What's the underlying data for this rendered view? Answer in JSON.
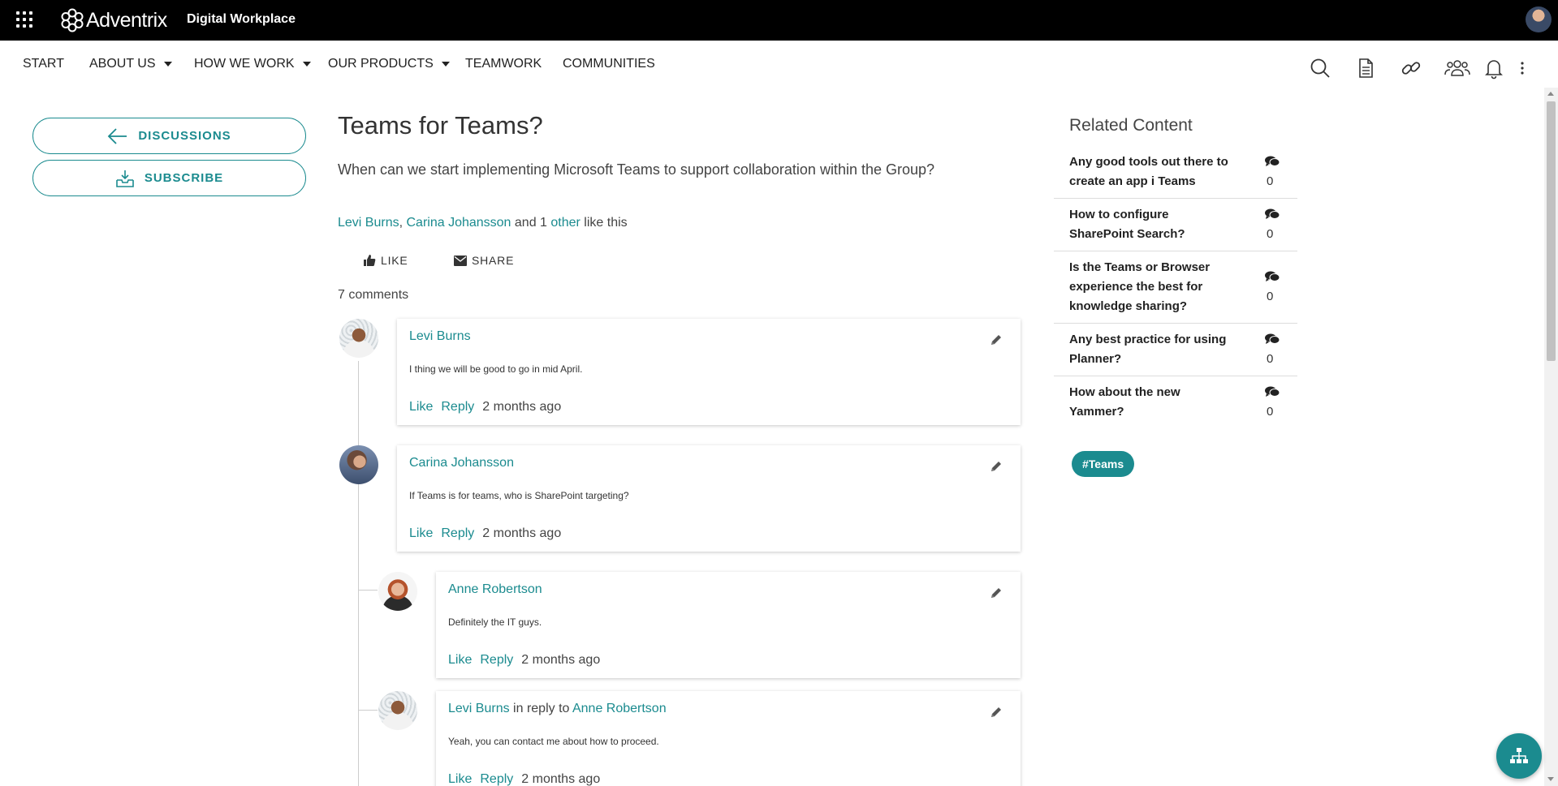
{
  "colors": {
    "accent": "#1b8b8f",
    "topbar": "#000000",
    "text": "#333333"
  },
  "topbar": {
    "logo_text": "Adventrix",
    "site_name": "Digital Workplace"
  },
  "nav": {
    "items": [
      {
        "label": "START",
        "dropdown": false
      },
      {
        "label": "ABOUT US",
        "dropdown": true
      },
      {
        "label": "HOW WE WORK",
        "dropdown": true
      },
      {
        "label": "OUR PRODUCTS",
        "dropdown": true
      },
      {
        "label": "TEAMWORK",
        "dropdown": false
      },
      {
        "label": "COMMUNITIES",
        "dropdown": false
      }
    ],
    "icons": [
      "search-icon",
      "document-icon",
      "link-icon",
      "people-icon",
      "bell-icon",
      "more-vertical-icon"
    ]
  },
  "sidebar": {
    "discussions_label": "DISCUSSIONS",
    "subscribe_label": "SUBSCRIBE"
  },
  "post": {
    "title": "Teams for Teams?",
    "question": "When can we start implementing Microsoft Teams to support collaboration within the Group?",
    "likers": {
      "first": "Levi Burns",
      "second": "Carina Johansson",
      "middle": " and 1 ",
      "other": "other",
      "suffix": " like this"
    },
    "like_label": "LIKE",
    "share_label": "SHARE",
    "comment_count": "7 comments"
  },
  "comments": [
    {
      "author": "Levi Burns",
      "text": "I thing we will be good to go in mid April.",
      "like": "Like",
      "reply": "Reply",
      "time": "2 months ago"
    },
    {
      "author": "Carina Johansson",
      "text": "If Teams is for teams, who is SharePoint targeting?",
      "like": "Like",
      "reply": "Reply",
      "time": "2 months ago"
    },
    {
      "author": "Anne Robertson",
      "text": "Definitely the IT guys.",
      "like": "Like",
      "reply": "Reply",
      "time": "2 months ago"
    },
    {
      "author": "Levi Burns",
      "in_reply": " in reply to ",
      "reply_to": "Anne Robertson",
      "text": "Yeah, you can contact me about how to proceed.",
      "like": "Like",
      "reply": "Reply",
      "time": "2 months ago"
    }
  ],
  "related": {
    "title": "Related Content",
    "items": [
      {
        "line1": "Any good tools out there to",
        "line2": "create an app i Teams",
        "count": "0"
      },
      {
        "line1": "How to configure",
        "line2": "SharePoint Search?",
        "count": "0"
      },
      {
        "line1": "Is the Teams or Browser",
        "line2": "experience the best for",
        "line3": "knowledge sharing?",
        "count": "0"
      },
      {
        "line1": "Any best practice for using",
        "line2": "Planner?",
        "count": "0"
      },
      {
        "line1": "How about the new",
        "line2": "Yammer?",
        "count": "0"
      }
    ],
    "tag": "#Teams"
  }
}
